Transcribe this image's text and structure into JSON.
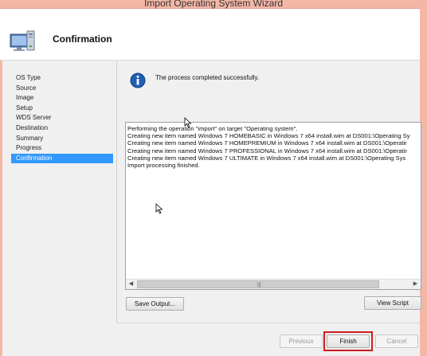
{
  "window": {
    "title": "Import Operating System Wizard"
  },
  "header": {
    "heading": "Confirmation",
    "icon": "computer-monitor-icon"
  },
  "sidebar": {
    "items": [
      {
        "label": "OS Type",
        "active": false
      },
      {
        "label": "Source",
        "active": false
      },
      {
        "label": "Image",
        "active": false
      },
      {
        "label": "Setup",
        "active": false
      },
      {
        "label": "WDS Server",
        "active": false
      },
      {
        "label": "Destination",
        "active": false
      },
      {
        "label": "Summary",
        "active": false
      },
      {
        "label": "Progress",
        "active": false
      },
      {
        "label": "Confirmation",
        "active": true
      }
    ]
  },
  "main": {
    "status_icon": "info-icon",
    "status_message": "The process completed successfully.",
    "log_lines": [
      "Performing the operation \"import\" on target \"Operating system\".",
      "Creating new item named Windows 7 HOMEBASIC in Windows 7 x64 install.wim at DS001:\\Operating Sy",
      "Creating new item named Windows 7 HOMEPREMIUM in Windows 7 x64 install.wim at DS001:\\Operatir",
      "Creating new item named Windows 7 PROFESSIONAL in Windows 7 x64 install.wim at DS001:\\Operatir",
      "Creating new item named Windows 7 ULTIMATE in Windows 7 x64 install.wim at DS001:\\Operating Sys",
      "Import processing finished."
    ],
    "save_output_label": "Save Output...",
    "view_script_label": "View Script"
  },
  "footer": {
    "previous_label": "Previous",
    "finish_label": "Finish",
    "cancel_label": "Cancel"
  },
  "colors": {
    "title_bar": "#f4b7a6",
    "selection": "#3399ff",
    "highlight_box": "#cc1d1d"
  }
}
